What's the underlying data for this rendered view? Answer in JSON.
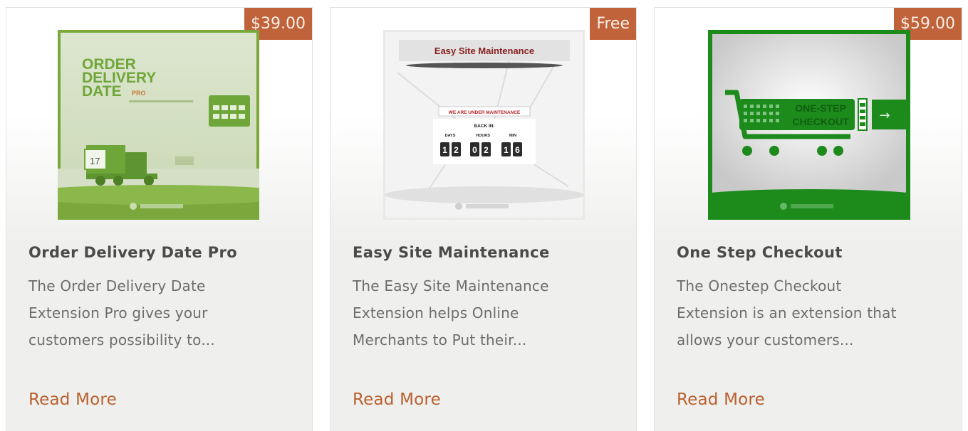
{
  "products": [
    {
      "price": "$39.00",
      "title": "Order Delivery Date Pro",
      "description_lines": [
        "The Order Delivery Date",
        "Extension Pro gives your",
        "customers possibility to..."
      ],
      "link": "Read More",
      "image": {
        "heading_lines": [
          "ORDER",
          "DELIVERY",
          "DATE"
        ],
        "badge": "PRO",
        "calendar_day": "17",
        "accent_color": "#6fa63a"
      }
    },
    {
      "price": "Free",
      "title": "Easy Site Maintenance",
      "description_lines": [
        "The Easy Site Maintenance",
        "Extension helps Online",
        "Merchants to Put their..."
      ],
      "link": "Read More",
      "image": {
        "banner": "Easy Site Maintenance",
        "notice": "WE ARE UNDER MAINTENANCE",
        "back_in": "BACK IN:",
        "units": [
          "DAYS",
          "HOURS",
          "MIN"
        ],
        "digits": [
          "1",
          "2",
          "0",
          "2",
          "1",
          "6"
        ]
      }
    },
    {
      "price": "$59.00",
      "title": "One Step Checkout",
      "description_lines": [
        "The Onestep Checkout",
        "Extension is an extension that",
        "allows your customers..."
      ],
      "link": "Read More",
      "image": {
        "label_lines": [
          "ONE-STEP",
          "CHECKOUT"
        ],
        "arrow": "→",
        "accent_color": "#1c8b1c"
      }
    }
  ],
  "colors": {
    "price_badge": "#c0633b",
    "read_more": "#b9612f",
    "title": "#4a4a4a",
    "text": "#6d6d6d"
  }
}
